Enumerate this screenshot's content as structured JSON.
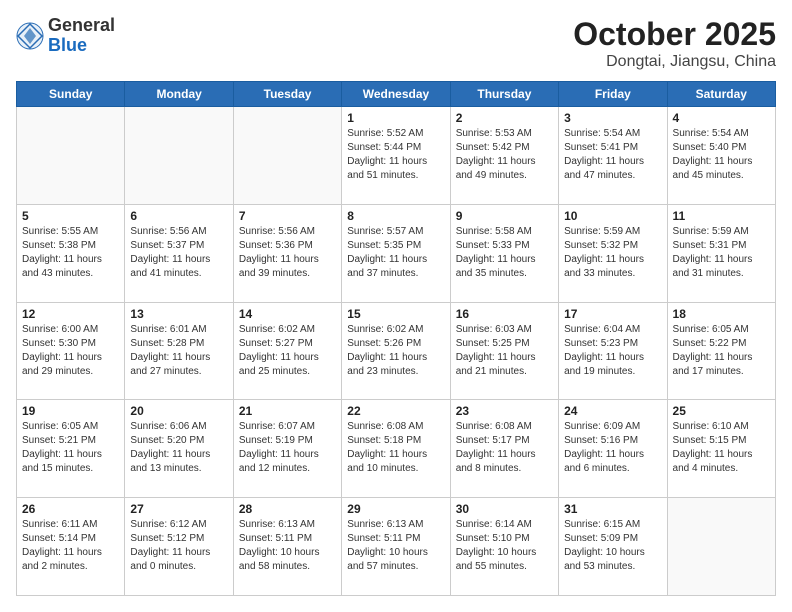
{
  "header": {
    "logo_general": "General",
    "logo_blue": "Blue",
    "month_title": "October 2025",
    "location": "Dongtai, Jiangsu, China"
  },
  "weekdays": [
    "Sunday",
    "Monday",
    "Tuesday",
    "Wednesday",
    "Thursday",
    "Friday",
    "Saturday"
  ],
  "weeks": [
    [
      {
        "day": "",
        "info": ""
      },
      {
        "day": "",
        "info": ""
      },
      {
        "day": "",
        "info": ""
      },
      {
        "day": "1",
        "info": "Sunrise: 5:52 AM\nSunset: 5:44 PM\nDaylight: 11 hours\nand 51 minutes."
      },
      {
        "day": "2",
        "info": "Sunrise: 5:53 AM\nSunset: 5:42 PM\nDaylight: 11 hours\nand 49 minutes."
      },
      {
        "day": "3",
        "info": "Sunrise: 5:54 AM\nSunset: 5:41 PM\nDaylight: 11 hours\nand 47 minutes."
      },
      {
        "day": "4",
        "info": "Sunrise: 5:54 AM\nSunset: 5:40 PM\nDaylight: 11 hours\nand 45 minutes."
      }
    ],
    [
      {
        "day": "5",
        "info": "Sunrise: 5:55 AM\nSunset: 5:38 PM\nDaylight: 11 hours\nand 43 minutes."
      },
      {
        "day": "6",
        "info": "Sunrise: 5:56 AM\nSunset: 5:37 PM\nDaylight: 11 hours\nand 41 minutes."
      },
      {
        "day": "7",
        "info": "Sunrise: 5:56 AM\nSunset: 5:36 PM\nDaylight: 11 hours\nand 39 minutes."
      },
      {
        "day": "8",
        "info": "Sunrise: 5:57 AM\nSunset: 5:35 PM\nDaylight: 11 hours\nand 37 minutes."
      },
      {
        "day": "9",
        "info": "Sunrise: 5:58 AM\nSunset: 5:33 PM\nDaylight: 11 hours\nand 35 minutes."
      },
      {
        "day": "10",
        "info": "Sunrise: 5:59 AM\nSunset: 5:32 PM\nDaylight: 11 hours\nand 33 minutes."
      },
      {
        "day": "11",
        "info": "Sunrise: 5:59 AM\nSunset: 5:31 PM\nDaylight: 11 hours\nand 31 minutes."
      }
    ],
    [
      {
        "day": "12",
        "info": "Sunrise: 6:00 AM\nSunset: 5:30 PM\nDaylight: 11 hours\nand 29 minutes."
      },
      {
        "day": "13",
        "info": "Sunrise: 6:01 AM\nSunset: 5:28 PM\nDaylight: 11 hours\nand 27 minutes."
      },
      {
        "day": "14",
        "info": "Sunrise: 6:02 AM\nSunset: 5:27 PM\nDaylight: 11 hours\nand 25 minutes."
      },
      {
        "day": "15",
        "info": "Sunrise: 6:02 AM\nSunset: 5:26 PM\nDaylight: 11 hours\nand 23 minutes."
      },
      {
        "day": "16",
        "info": "Sunrise: 6:03 AM\nSunset: 5:25 PM\nDaylight: 11 hours\nand 21 minutes."
      },
      {
        "day": "17",
        "info": "Sunrise: 6:04 AM\nSunset: 5:23 PM\nDaylight: 11 hours\nand 19 minutes."
      },
      {
        "day": "18",
        "info": "Sunrise: 6:05 AM\nSunset: 5:22 PM\nDaylight: 11 hours\nand 17 minutes."
      }
    ],
    [
      {
        "day": "19",
        "info": "Sunrise: 6:05 AM\nSunset: 5:21 PM\nDaylight: 11 hours\nand 15 minutes."
      },
      {
        "day": "20",
        "info": "Sunrise: 6:06 AM\nSunset: 5:20 PM\nDaylight: 11 hours\nand 13 minutes."
      },
      {
        "day": "21",
        "info": "Sunrise: 6:07 AM\nSunset: 5:19 PM\nDaylight: 11 hours\nand 12 minutes."
      },
      {
        "day": "22",
        "info": "Sunrise: 6:08 AM\nSunset: 5:18 PM\nDaylight: 11 hours\nand 10 minutes."
      },
      {
        "day": "23",
        "info": "Sunrise: 6:08 AM\nSunset: 5:17 PM\nDaylight: 11 hours\nand 8 minutes."
      },
      {
        "day": "24",
        "info": "Sunrise: 6:09 AM\nSunset: 5:16 PM\nDaylight: 11 hours\nand 6 minutes."
      },
      {
        "day": "25",
        "info": "Sunrise: 6:10 AM\nSunset: 5:15 PM\nDaylight: 11 hours\nand 4 minutes."
      }
    ],
    [
      {
        "day": "26",
        "info": "Sunrise: 6:11 AM\nSunset: 5:14 PM\nDaylight: 11 hours\nand 2 minutes."
      },
      {
        "day": "27",
        "info": "Sunrise: 6:12 AM\nSunset: 5:12 PM\nDaylight: 11 hours\nand 0 minutes."
      },
      {
        "day": "28",
        "info": "Sunrise: 6:13 AM\nSunset: 5:11 PM\nDaylight: 10 hours\nand 58 minutes."
      },
      {
        "day": "29",
        "info": "Sunrise: 6:13 AM\nSunset: 5:11 PM\nDaylight: 10 hours\nand 57 minutes."
      },
      {
        "day": "30",
        "info": "Sunrise: 6:14 AM\nSunset: 5:10 PM\nDaylight: 10 hours\nand 55 minutes."
      },
      {
        "day": "31",
        "info": "Sunrise: 6:15 AM\nSunset: 5:09 PM\nDaylight: 10 hours\nand 53 minutes."
      },
      {
        "day": "",
        "info": ""
      }
    ]
  ]
}
